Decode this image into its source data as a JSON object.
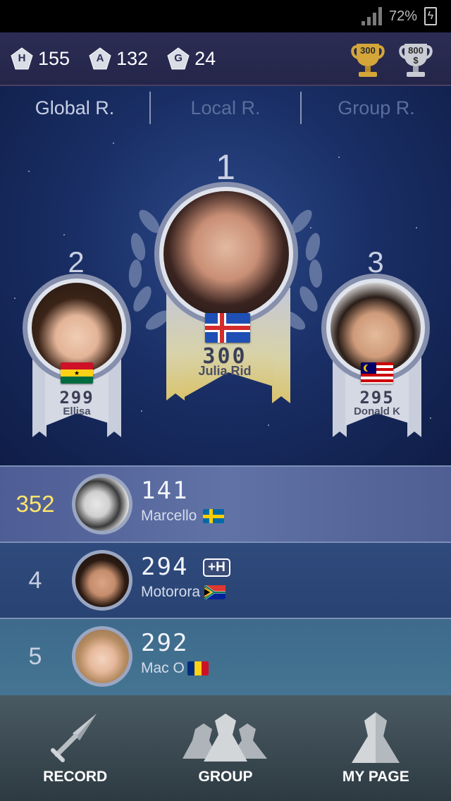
{
  "status_bar": {
    "battery_percent": "72%"
  },
  "header": {
    "stats": [
      {
        "letter": "H",
        "value": "155"
      },
      {
        "letter": "A",
        "value": "132"
      },
      {
        "letter": "G",
        "value": "24"
      }
    ],
    "trophies": [
      {
        "label": "300",
        "sub": "",
        "color": "#d4a63a"
      },
      {
        "label": "800",
        "sub": "$",
        "color": "#c9ccd3"
      }
    ]
  },
  "tabs": [
    {
      "label": "Global R.",
      "active": true
    },
    {
      "label": "Local R.",
      "active": false
    },
    {
      "label": "Group R.",
      "active": false
    }
  ],
  "podium": [
    {
      "rank": "1",
      "score": "300",
      "name": "Julia Rid",
      "flag": "iceland"
    },
    {
      "rank": "2",
      "score": "299",
      "name": "Ellisa",
      "flag": "ghana"
    },
    {
      "rank": "3",
      "score": "295",
      "name": "Donald K",
      "flag": "malaysia"
    }
  ],
  "list": [
    {
      "rank": "352",
      "score": "141",
      "name": "Marcello",
      "flag": "sweden",
      "badge": "",
      "is_me": true
    },
    {
      "rank": "4",
      "score": "294",
      "name": "Motorora",
      "flag": "south-africa",
      "badge": "+H",
      "is_me": false
    },
    {
      "rank": "5",
      "score": "292",
      "name": "Mac O",
      "flag": "romania",
      "badge": "",
      "is_me": false
    }
  ],
  "nav": [
    {
      "label": "RECORD",
      "icon": "spear-icon"
    },
    {
      "label": "GROUP",
      "icon": "group-icon"
    },
    {
      "label": "MY PAGE",
      "icon": "person-icon"
    }
  ],
  "colors": {
    "gold": "#ffe66a",
    "header_bg": "#2b2d54",
    "main_bg": "#1a2f66",
    "nav_bg": "#3b4a52"
  }
}
